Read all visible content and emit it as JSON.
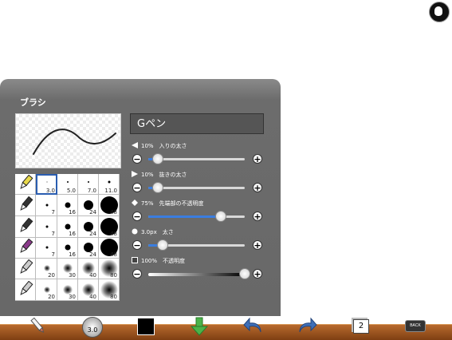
{
  "panel": {
    "title": "ブラシ"
  },
  "brush_name": "Gペン",
  "brush_grid": {
    "header_sizes": [
      "3.0",
      "5.0",
      "7.0",
      "11.0"
    ],
    "row_sizes": [
      [
        "7",
        "16",
        "24",
        "48"
      ],
      [
        "7",
        "16",
        "24",
        "48"
      ],
      [
        "7",
        "16",
        "24",
        "48"
      ],
      [
        "20",
        "30",
        "40",
        "80"
      ],
      [
        "20",
        "30",
        "40",
        "80"
      ]
    ]
  },
  "sliders": [
    {
      "label": "10%　入りの太さ",
      "value": 0.1,
      "icon": "triangle-left-icon"
    },
    {
      "label": "10%　抜きの太さ",
      "value": 0.1,
      "icon": "triangle-right-icon"
    },
    {
      "label": "75%　先端部の不透明度",
      "value": 0.75,
      "icon": "diamond-icon"
    },
    {
      "label": "3.0px　太さ",
      "value": 0.15,
      "icon": "circle-icon"
    },
    {
      "label": "100%　不透明度",
      "value": 1.0,
      "icon": "square-icon"
    }
  ],
  "toolbar": {
    "brush_size": "3.0",
    "page_count": "2",
    "back_label": "BACK"
  },
  "colors": {
    "accent": "#3a7de0",
    "selection": "#2a5db0",
    "toolbar": "#9a5220",
    "panel": "#6c6c6c"
  }
}
